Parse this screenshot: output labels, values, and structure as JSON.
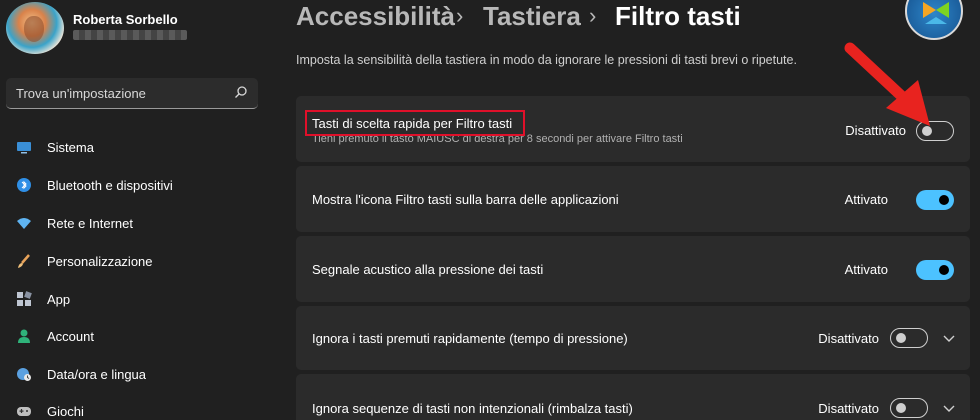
{
  "user": {
    "name": "Roberta Sorbello"
  },
  "search": {
    "placeholder": "Trova un'impostazione",
    "icon": "search-icon"
  },
  "sidebar": {
    "items": [
      {
        "label": "Sistema",
        "icon": "monitor-icon",
        "color": "#3a8fd6"
      },
      {
        "label": "Bluetooth e dispositivi",
        "icon": "bluetooth-icon",
        "color": "#2f8fe6"
      },
      {
        "label": "Rete e Internet",
        "icon": "wifi-icon",
        "color": "#5fb4f2"
      },
      {
        "label": "Personalizzazione",
        "icon": "brush-icon",
        "color": "#e8a35a"
      },
      {
        "label": "App",
        "icon": "apps-icon",
        "color": "#bfc6d2"
      },
      {
        "label": "Account",
        "icon": "account-icon",
        "color": "#2fb37a"
      },
      {
        "label": "Data/ora e lingua",
        "icon": "globe-clock-icon",
        "color": "#5aa0e0"
      },
      {
        "label": "Giochi",
        "icon": "gamepad-icon",
        "color": "#bfbfbf"
      }
    ]
  },
  "breadcrumb": {
    "items": [
      "Accessibilità",
      "Tastiera",
      "Filtro tasti"
    ],
    "separator": "›"
  },
  "description": "Imposta la sensibilità della tastiera in modo da ignorare le pressioni di tasti brevi o ripetute.",
  "settings": [
    {
      "title": "Tasti di scelta rapida per Filtro tasti",
      "subtitle": "Tieni premuto il tasto MAIUSC di destra per 8 secondi per attivare Filtro tasti",
      "state": "Disattivato",
      "on": false,
      "expandable": false
    },
    {
      "title": "Mostra l'icona Filtro tasti sulla barra delle applicazioni",
      "state": "Attivato",
      "on": true,
      "expandable": false
    },
    {
      "title": "Segnale acustico alla pressione dei tasti",
      "state": "Attivato",
      "on": true,
      "expandable": false
    },
    {
      "title": "Ignora i tasti premuti rapidamente (tempo di pressione)",
      "state": "Disattivato",
      "on": false,
      "expandable": true
    },
    {
      "title": "Ignora sequenze di tasti non intenzionali (rimbalza tasti)",
      "state": "Disattivato",
      "on": false,
      "expandable": true
    }
  ],
  "colors": {
    "accent": "#4cc2ff",
    "highlight": "#e0102a",
    "arrow": "#e8231f"
  }
}
